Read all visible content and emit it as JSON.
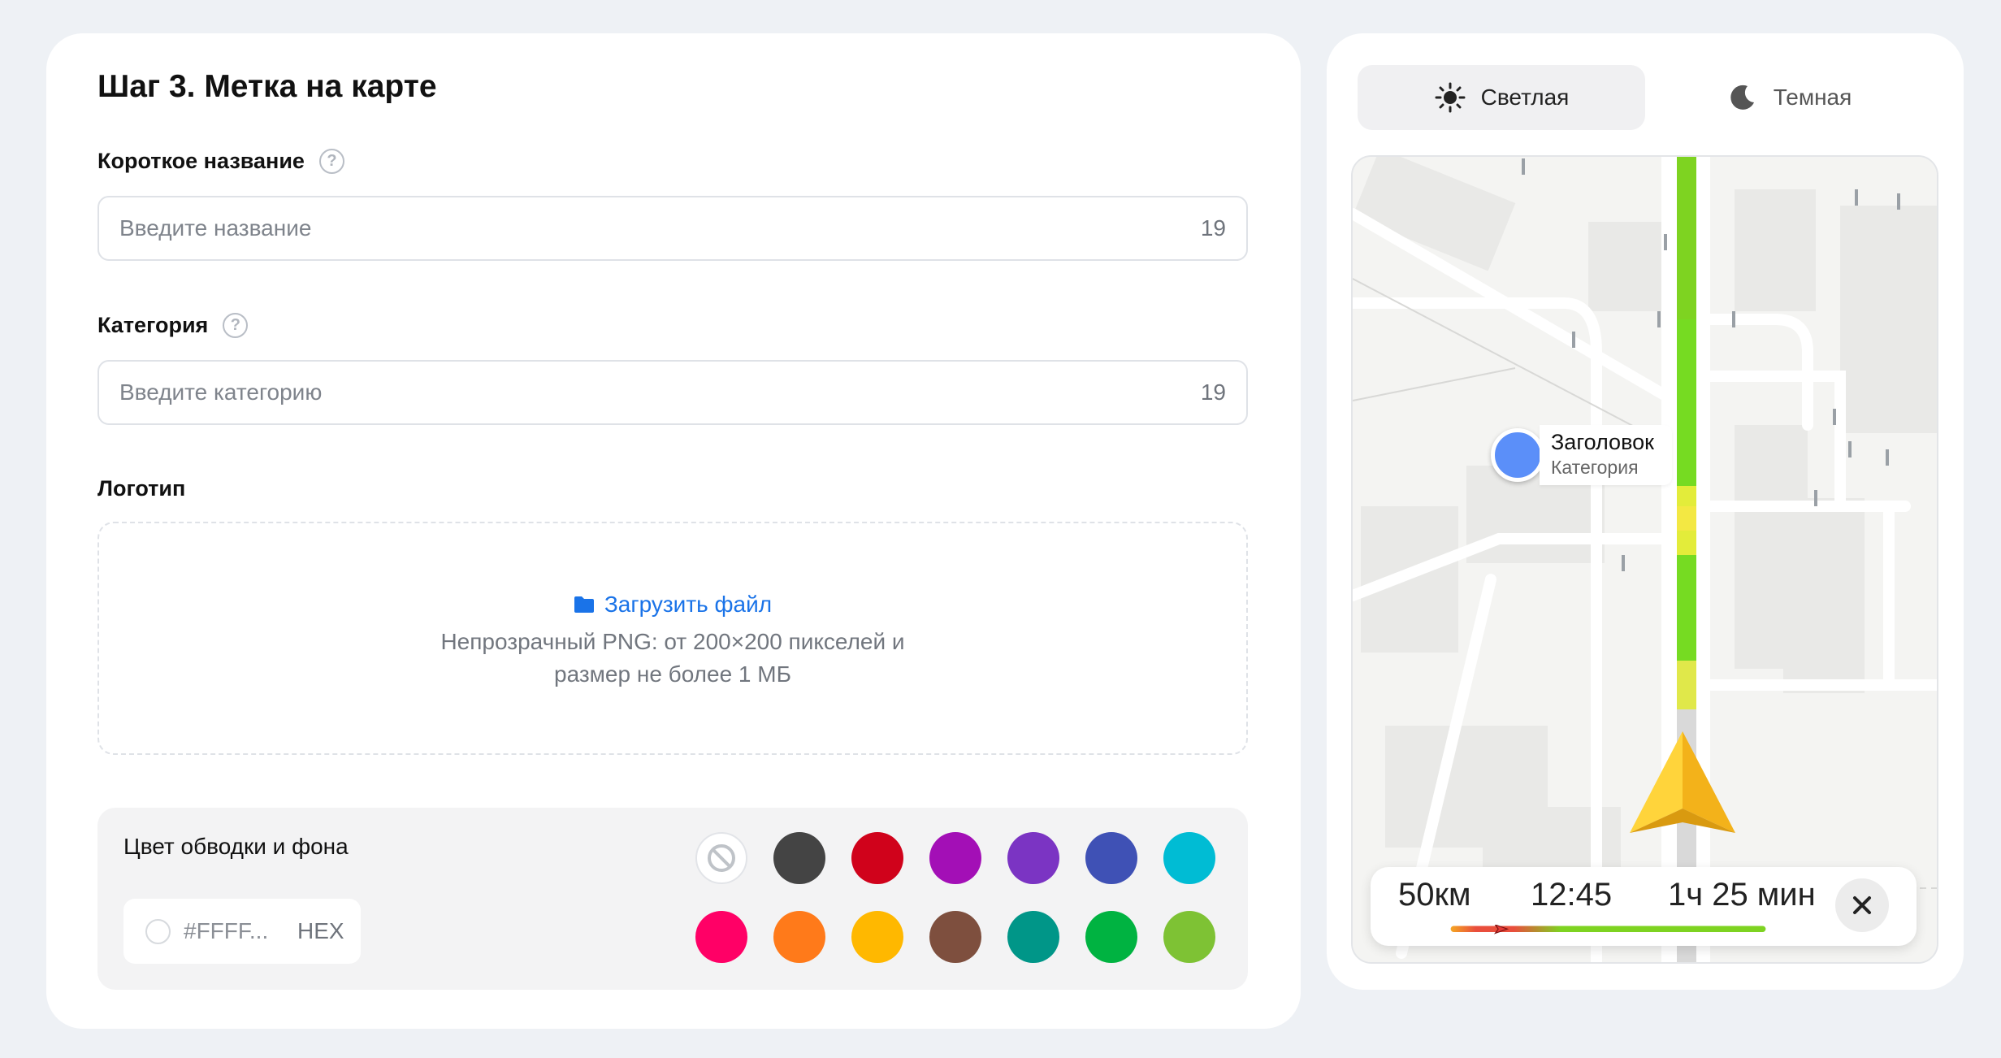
{
  "form": {
    "step_title": "Шаг 3. Метка на карте",
    "short_name": {
      "label": "Короткое название",
      "placeholder": "Введите название",
      "counter": "19"
    },
    "category": {
      "label": "Категория",
      "placeholder": "Введите категорию",
      "counter": "19"
    },
    "logo": {
      "label": "Логотип",
      "upload_link": "Загрузить файл",
      "hint_line1": "Непрозрачный PNG: от 200×200 пикселей и",
      "hint_line2": "размер не более 1 МБ"
    },
    "colors": {
      "title": "Цвет обводки и фона",
      "hex_value": "#FFFF...",
      "hex_suffix": "HEX",
      "swatches_row1": [
        "none",
        "#444444",
        "#d0021b",
        "#a30fb6",
        "#7b34c3",
        "#3f51b5",
        "#00bcd4"
      ],
      "swatches_row2": [
        "#ff0066",
        "#ff7a1a",
        "#ffb800",
        "#7e4f3e",
        "#009688",
        "#00b341",
        "#7ec234"
      ]
    }
  },
  "preview": {
    "theme_tabs": [
      {
        "label": "Светлая",
        "icon": "sun-icon",
        "active": true
      },
      {
        "label": "Темная",
        "icon": "moon-icon",
        "active": false
      }
    ],
    "pin": {
      "title": "Заголовок",
      "subtitle": "Категория",
      "color": "#5b8ff9"
    },
    "navigation": {
      "distance": "50км",
      "arrival_time": "12:45",
      "duration": "1ч 25 мин",
      "progress": 0.18
    },
    "accent_route_color": "#7ed321"
  }
}
